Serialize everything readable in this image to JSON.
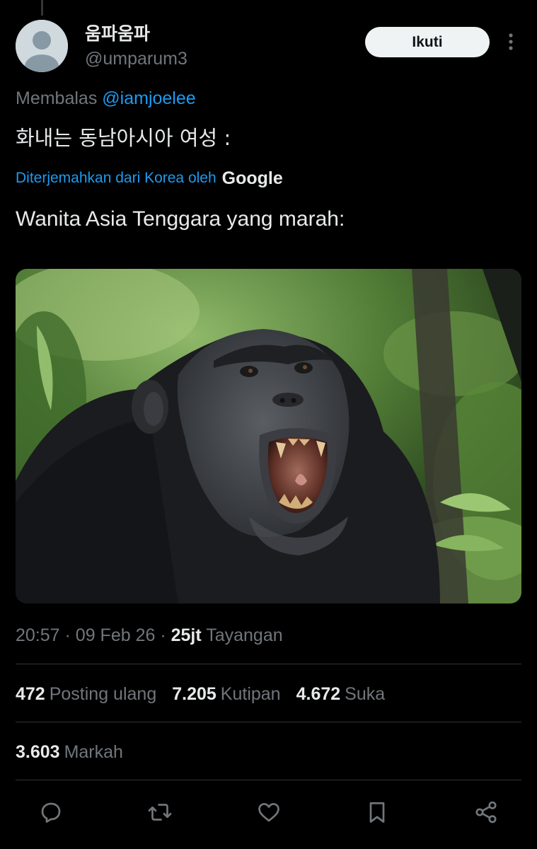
{
  "tweet": {
    "display_name": "움파움파",
    "handle": "@umparum3",
    "follow_label": "Ikuti",
    "reply_prefix": "Membalas",
    "reply_to": "@iamjoelee",
    "original_text": "화내는 동남아시아 여성 :",
    "translated_by": "Diterjemahkan dari Korea oleh",
    "translator_brand": "Google",
    "translated_text": "Wanita Asia Tenggara yang marah:",
    "media_alt": "chimpanzee-photo"
  },
  "meta": {
    "time": "20:57",
    "date": "09 Feb 26",
    "views_count": "25jt",
    "views_label": "Tayangan"
  },
  "stats": {
    "reposts_count": "472",
    "reposts_label": "Posting ulang",
    "quotes_count": "7.205",
    "quotes_label": "Kutipan",
    "likes_count": "4.672",
    "likes_label": "Suka",
    "bookmarks_count": "3.603",
    "bookmarks_label": "Markah"
  },
  "icons": {
    "reply": "reply-icon",
    "repost": "repost-icon",
    "like": "heart-icon",
    "bookmark": "bookmark-icon",
    "share": "share-icon",
    "more": "more-icon"
  },
  "colors": {
    "background": "#000000",
    "accent": "#1d9bf0",
    "text_primary": "#e7e9ea",
    "text_secondary": "#71767b",
    "divider": "#2f3336",
    "follow_button_bg": "#eff3f4"
  }
}
